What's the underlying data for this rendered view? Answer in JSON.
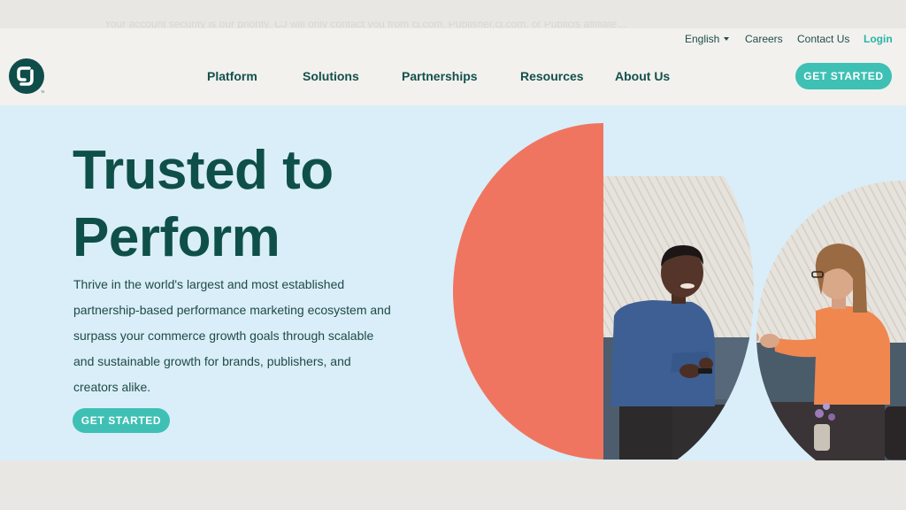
{
  "alert_bar": {
    "text": "Your account security is our priority. CJ will only contact you from cj.com, Publisher.cj.com, or Publicis affiliate..."
  },
  "utility_bar": {
    "language": "English",
    "careers": "Careers",
    "contact": "Contact Us",
    "login": "Login"
  },
  "nav": {
    "logo_text": "CJ",
    "items": [
      "Platform",
      "Solutions",
      "Partnerships",
      "Resources",
      "About Us"
    ],
    "cta": "GET STARTED"
  },
  "hero": {
    "title_line1": "Trusted to",
    "title_line2": "Perform",
    "body": "Thrive in the world's largest and most established partnership-based performance marketing ecosystem and surpass your commerce growth goals through scalable and sustainable growth for brands, publishers, and creators alike.",
    "cta": "GET STARTED"
  },
  "colors": {
    "brand_dark": "#0e4d4a",
    "accent_teal": "#3fc0b4",
    "hero_bg": "#d9eef8",
    "coral": "#f07560",
    "nav_bg": "#f2f1ee"
  }
}
